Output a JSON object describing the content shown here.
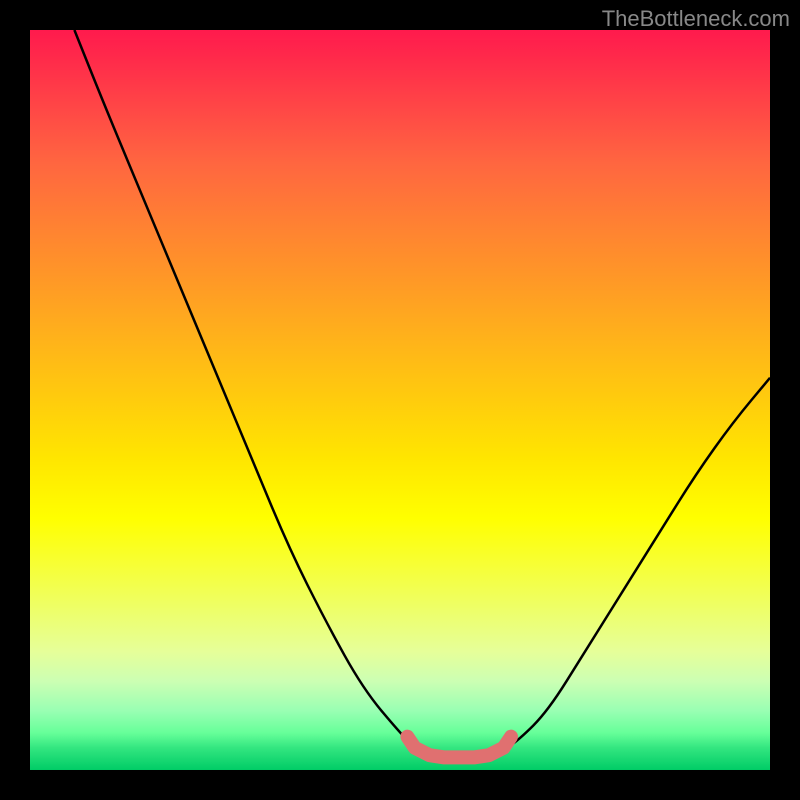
{
  "watermark": "TheBottleneck.com",
  "chart_data": {
    "type": "line",
    "title": "",
    "xlabel": "",
    "ylabel": "",
    "xlim": [
      0,
      100
    ],
    "ylim": [
      0,
      100
    ],
    "series": [
      {
        "name": "bottleneck-curve",
        "color": "#000000",
        "points": [
          {
            "x": 6,
            "y": 100
          },
          {
            "x": 10,
            "y": 90
          },
          {
            "x": 15,
            "y": 78
          },
          {
            "x": 20,
            "y": 66
          },
          {
            "x": 25,
            "y": 54
          },
          {
            "x": 30,
            "y": 42
          },
          {
            "x": 35,
            "y": 30
          },
          {
            "x": 40,
            "y": 20
          },
          {
            "x": 45,
            "y": 11
          },
          {
            "x": 50,
            "y": 5
          },
          {
            "x": 53,
            "y": 2
          },
          {
            "x": 56,
            "y": 1.5
          },
          {
            "x": 60,
            "y": 1.5
          },
          {
            "x": 63,
            "y": 2
          },
          {
            "x": 66,
            "y": 4
          },
          {
            "x": 70,
            "y": 8
          },
          {
            "x": 75,
            "y": 16
          },
          {
            "x": 80,
            "y": 24
          },
          {
            "x": 85,
            "y": 32
          },
          {
            "x": 90,
            "y": 40
          },
          {
            "x": 95,
            "y": 47
          },
          {
            "x": 100,
            "y": 53
          }
        ]
      },
      {
        "name": "optimal-zone-marker",
        "color": "#e07070",
        "points": [
          {
            "x": 51,
            "y": 4.5
          },
          {
            "x": 52,
            "y": 3
          },
          {
            "x": 54,
            "y": 2
          },
          {
            "x": 56,
            "y": 1.7
          },
          {
            "x": 58,
            "y": 1.7
          },
          {
            "x": 60,
            "y": 1.7
          },
          {
            "x": 62,
            "y": 2
          },
          {
            "x": 64,
            "y": 3
          },
          {
            "x": 65,
            "y": 4.5
          }
        ]
      }
    ],
    "grid": false,
    "legend_position": "none"
  }
}
